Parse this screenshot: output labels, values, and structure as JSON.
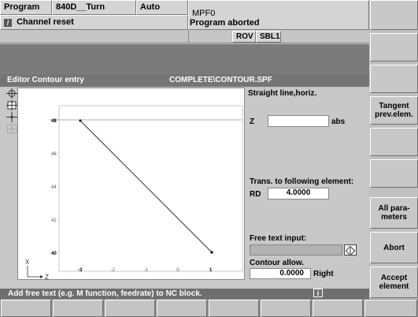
{
  "header": {
    "area": "Program",
    "machine": "840D__Turn",
    "mode": "Auto",
    "program": "MPF0",
    "channel_status": "Channel reset",
    "program_status": "Program aborted",
    "flags": [
      "ROV",
      "SBL1"
    ]
  },
  "editor": {
    "title": "Editor  Contour entry",
    "file": "COMPLETE\\CONTOUR.SPF"
  },
  "panel": {
    "heading": "Straight line,horiz.",
    "z_label": "Z",
    "z_value": "",
    "z_unit": "abs",
    "trans_label": "Trans. to following element:",
    "rd_label": "RD",
    "rd_value": "4.0000",
    "free_text_label": "Free text input:",
    "free_text_value": "",
    "contour_allow_label": "Contour allow.",
    "contour_allow_value": "0.0000",
    "contour_allow_side": "Right"
  },
  "graphic": {
    "x_ticks": [
      "-3",
      "-2",
      "-1",
      "0",
      "1"
    ],
    "y_ticks": [
      "40",
      "42",
      "44",
      "46",
      "48"
    ],
    "axis_x_label": "X",
    "axis_z_label": "Z"
  },
  "status_message": "Add free text (e.g. M function, feedrate) to NC block.",
  "info_icon": "i",
  "vertical_softkeys": [
    "",
    "",
    "",
    "Tangent prev.elem.",
    "",
    "",
    "All para-meters",
    "Abort",
    "Accept element"
  ],
  "horizontal_softkeys": [
    "",
    "",
    "",
    "",
    "",
    "",
    "",
    ""
  ],
  "colors": {
    "header_bar": "#7b7b7b",
    "status_bar": "#6e6e6e",
    "graphic_bg": "#ffffff"
  }
}
